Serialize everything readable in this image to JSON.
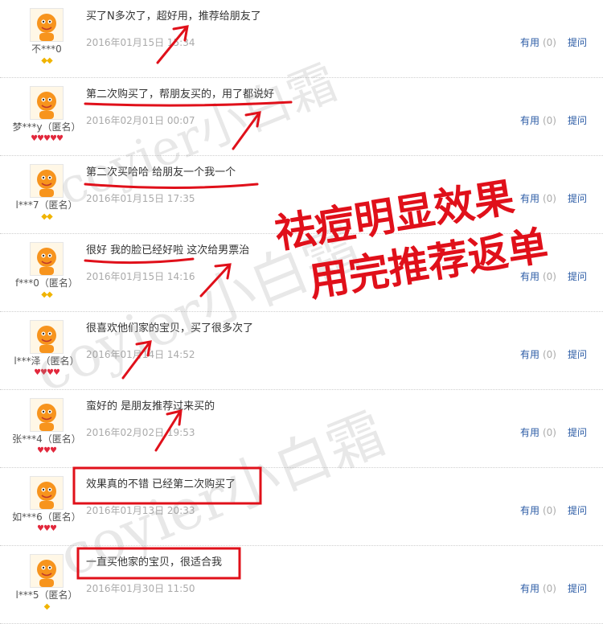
{
  "reviews": [
    {
      "user": "不***0",
      "rank": "◆◆",
      "rank_color": "gold",
      "text": "买了N多次了，超好用，推荐给朋友了",
      "date": "2016年01月15日 15:34",
      "useful_label": "有用",
      "useful_count": "(0)",
      "reply_label": "提问"
    },
    {
      "user": "梦***y（匿名）",
      "rank": "♥♥♥♥♥",
      "rank_color": "red",
      "text": "第二次购买了，帮朋友买的，用了都说好",
      "date": "2016年02月01日 00:07",
      "useful_label": "有用",
      "useful_count": "(0)",
      "reply_label": "提问"
    },
    {
      "user": "l***7（匿名）",
      "rank": "◆◆",
      "rank_color": "gold",
      "text": "第二次买哈哈 给朋友一个我一个",
      "date": "2016年01月15日 17:35",
      "useful_label": "有用",
      "useful_count": "(0)",
      "reply_label": "提问"
    },
    {
      "user": "f***0（匿名）",
      "rank": "◆◆",
      "rank_color": "gold",
      "text": "很好 我的脸已经好啦 这次给男票治",
      "date": "2016年01月15日 14:16",
      "useful_label": "有用",
      "useful_count": "(0)",
      "reply_label": "提问"
    },
    {
      "user": "l***泽（匿名）",
      "rank": "♥♥♥♥",
      "rank_color": "red",
      "text": "很喜欢他们家的宝贝，买了很多次了",
      "date": "2016年01月14日 14:52",
      "useful_label": "有用",
      "useful_count": "(0)",
      "reply_label": "提问"
    },
    {
      "user": "张***4（匿名）",
      "rank": "♥♥♥",
      "rank_color": "red",
      "text": "蛮好的 是朋友推荐过来买的",
      "date": "2016年02月02日 19:53",
      "useful_label": "有用",
      "useful_count": "(0)",
      "reply_label": "提问"
    },
    {
      "user": "如***6（匿名）",
      "rank": "♥♥♥",
      "rank_color": "red",
      "text": "效果真的不错 已经第二次购买了",
      "date": "2016年01月13日 20:33",
      "useful_label": "有用",
      "useful_count": "(0)",
      "reply_label": "提问"
    },
    {
      "user": "l***5（匿名）",
      "rank": "◆",
      "rank_color": "gold",
      "text": "一直买他家的宝贝，很适合我",
      "date": "2016年01月30日 11:50",
      "useful_label": "有用",
      "useful_count": "(0)",
      "reply_label": "提问"
    }
  ],
  "overlay": {
    "line1": "祛痘明显效果",
    "line2": "用完推荐返单"
  },
  "watermark": {
    "text": "coyier小白霜"
  },
  "colors": {
    "annotation": "#e0101a",
    "link": "#2b5ba5",
    "date": "#aaaaaa"
  }
}
